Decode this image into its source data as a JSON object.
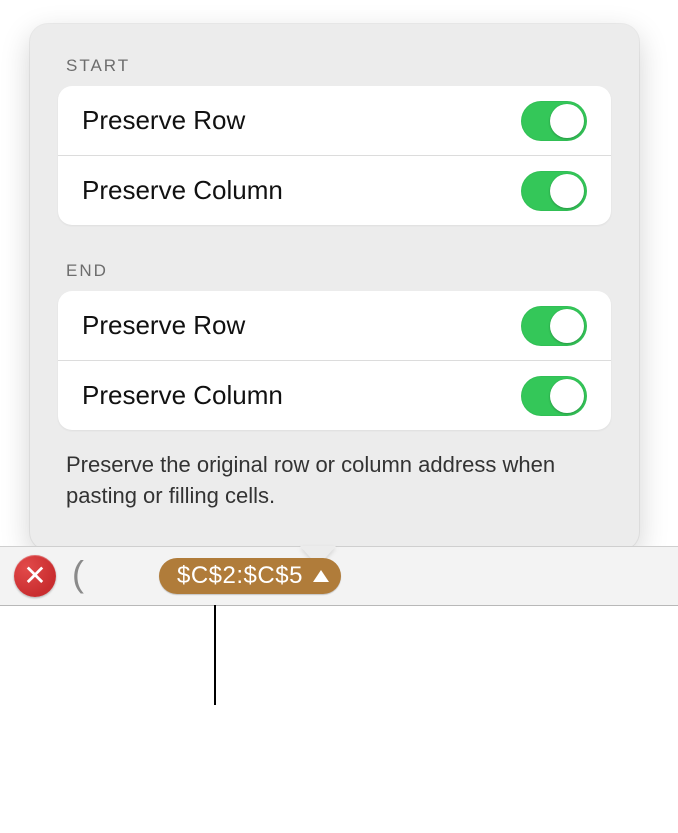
{
  "sections": {
    "start": {
      "label": "START",
      "preserve_row": {
        "label": "Preserve Row",
        "on": true
      },
      "preserve_col": {
        "label": "Preserve Column",
        "on": true
      }
    },
    "end": {
      "label": "END",
      "preserve_row": {
        "label": "Preserve Row",
        "on": true
      },
      "preserve_col": {
        "label": "Preserve Column",
        "on": true
      }
    }
  },
  "help_text": "Preserve the original row or column address when pasting or filling cells.",
  "formula_bar": {
    "close_glyph": "✕",
    "token_text": "$C$2:$C$5"
  },
  "colors": {
    "switch_on": "#34C759",
    "token_bg": "#b07c3a",
    "close_bg": "#c92d2f"
  }
}
